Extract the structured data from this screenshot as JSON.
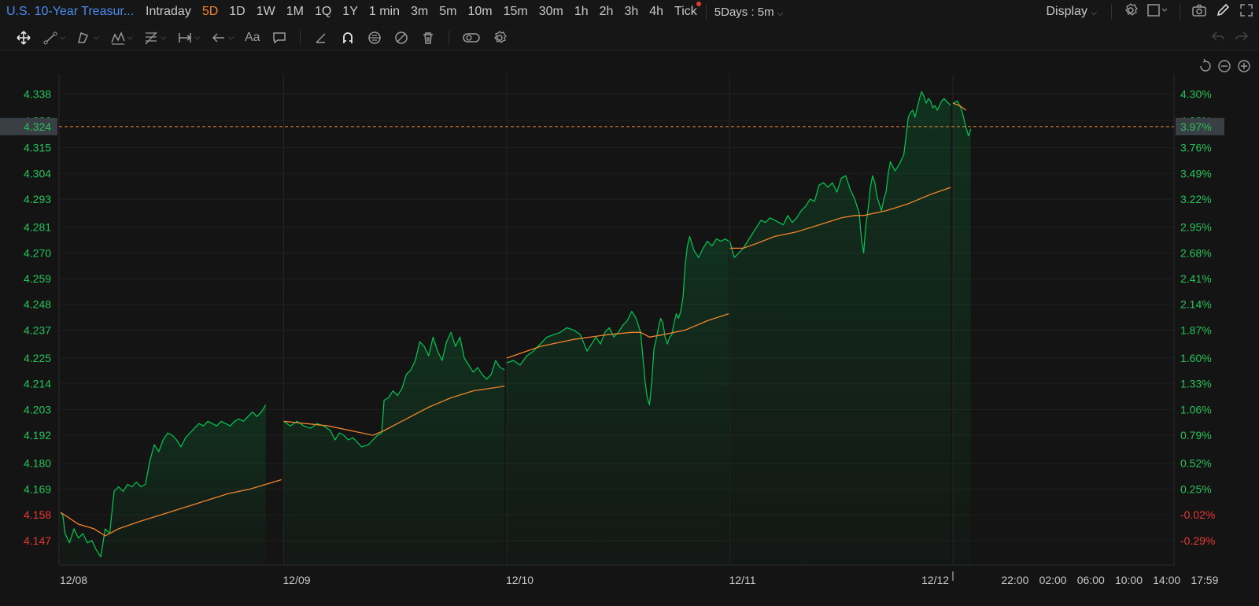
{
  "app": {
    "symbol_title": "U.S. 10-Year Treasur...",
    "timeframes": [
      "Intraday",
      "5D",
      "1D",
      "1W",
      "1M",
      "1Q",
      "1Y",
      "1 min",
      "3m",
      "5m",
      "10m",
      "15m",
      "30m",
      "1h",
      "2h",
      "3h",
      "4h",
      "Tick"
    ],
    "active_timeframe": "5D",
    "period_select": "5Days : 5m",
    "display_label": "Display"
  },
  "toolbar": {
    "text_tool_label": "Aa",
    "icons": [
      "move-icon",
      "trendline-icon",
      "pattern-icon",
      "wave-icon",
      "fib-icon",
      "measure-icon",
      "arrow-icon",
      "text-icon",
      "comment-icon",
      "ruler-icon",
      "magnet-icon",
      "lock-icon",
      "hide-icon",
      "trash-icon",
      "compare-icon",
      "settings-icon",
      "undo-icon",
      "redo-icon"
    ]
  },
  "colors": {
    "price_line": "#00c853",
    "avg_line": "#f0842c",
    "up_text": "#26c35a",
    "down_text": "#e53935",
    "ref_line": "#f0842c",
    "active_tf": "#f0842c",
    "title": "#4a8cf0"
  },
  "chart_data": {
    "type": "area",
    "prev_close": 4.159,
    "current_price": "4.324",
    "current_pct": "3.97%",
    "ylim": [
      4.1365,
      4.3465
    ],
    "left_ticks": [
      "4.338",
      "4.326",
      "4.315",
      "4.304",
      "4.293",
      "4.281",
      "4.270",
      "4.259",
      "4.248",
      "4.237",
      "4.225",
      "4.214",
      "4.203",
      "4.192",
      "4.180",
      "4.169",
      "4.158",
      "4.147"
    ],
    "left_tick_values": [
      4.338,
      4.3265,
      4.315,
      4.304,
      4.293,
      4.281,
      4.27,
      4.259,
      4.248,
      4.237,
      4.225,
      4.214,
      4.203,
      4.192,
      4.18,
      4.169,
      4.158,
      4.147
    ],
    "right_ticks": [
      "4.30%",
      "4.03%",
      "3.76%",
      "3.49%",
      "3.22%",
      "2.95%",
      "2.68%",
      "2.41%",
      "2.14%",
      "1.87%",
      "1.60%",
      "1.33%",
      "1.06%",
      "0.79%",
      "0.52%",
      "0.25%",
      "-0.02%",
      "-0.29%"
    ],
    "x_labels": [
      "12/08",
      "12/09",
      "12/10",
      "12/11",
      "12/12",
      "22:00",
      "02:00",
      "06:00",
      "10:00",
      "14:00",
      "17:59"
    ],
    "x_label_pos": [
      0,
      1,
      2,
      3,
      4,
      4.22,
      4.39,
      4.56,
      4.73,
      4.9,
      5.07
    ],
    "session_breaks": [
      1,
      2,
      3,
      4
    ],
    "days": [
      {
        "name": "12/08",
        "price": [
          [
            0.0,
            4.159
          ],
          [
            0.01,
            4.158
          ],
          [
            0.02,
            4.15
          ],
          [
            0.04,
            4.146
          ],
          [
            0.06,
            4.152
          ],
          [
            0.08,
            4.148
          ],
          [
            0.1,
            4.15
          ],
          [
            0.12,
            4.146
          ],
          [
            0.14,
            4.147
          ],
          [
            0.16,
            4.143
          ],
          [
            0.18,
            4.14
          ],
          [
            0.2,
            4.152
          ],
          [
            0.22,
            4.15
          ],
          [
            0.24,
            4.168
          ],
          [
            0.26,
            4.17
          ],
          [
            0.28,
            4.168
          ],
          [
            0.3,
            4.171
          ],
          [
            0.32,
            4.17
          ],
          [
            0.34,
            4.172
          ],
          [
            0.36,
            4.17
          ],
          [
            0.38,
            4.171
          ],
          [
            0.4,
            4.181
          ],
          [
            0.42,
            4.188
          ],
          [
            0.44,
            4.185
          ],
          [
            0.46,
            4.19
          ],
          [
            0.48,
            4.193
          ],
          [
            0.5,
            4.192
          ],
          [
            0.52,
            4.19
          ],
          [
            0.54,
            4.187
          ],
          [
            0.56,
            4.191
          ],
          [
            0.58,
            4.193
          ],
          [
            0.6,
            4.195
          ],
          [
            0.62,
            4.197
          ],
          [
            0.64,
            4.196
          ],
          [
            0.66,
            4.198
          ],
          [
            0.68,
            4.197
          ],
          [
            0.7,
            4.196
          ],
          [
            0.72,
            4.198
          ],
          [
            0.74,
            4.197
          ],
          [
            0.76,
            4.196
          ],
          [
            0.78,
            4.198
          ],
          [
            0.8,
            4.199
          ],
          [
            0.82,
            4.198
          ],
          [
            0.84,
            4.2
          ],
          [
            0.86,
            4.202
          ],
          [
            0.88,
            4.2
          ],
          [
            0.9,
            4.202
          ],
          [
            0.92,
            4.205
          ]
        ],
        "avg": [
          [
            0.0,
            4.159
          ],
          [
            0.08,
            4.154
          ],
          [
            0.15,
            4.152
          ],
          [
            0.2,
            4.149
          ],
          [
            0.26,
            4.152
          ],
          [
            0.35,
            4.155
          ],
          [
            0.45,
            4.158
          ],
          [
            0.55,
            4.161
          ],
          [
            0.65,
            4.164
          ],
          [
            0.75,
            4.167
          ],
          [
            0.85,
            4.169
          ],
          [
            0.99,
            4.173
          ]
        ]
      },
      {
        "name": "12/09",
        "price": [
          [
            0.0,
            4.198
          ],
          [
            0.03,
            4.196
          ],
          [
            0.06,
            4.198
          ],
          [
            0.09,
            4.196
          ],
          [
            0.12,
            4.195
          ],
          [
            0.15,
            4.197
          ],
          [
            0.18,
            4.196
          ],
          [
            0.21,
            4.194
          ],
          [
            0.23,
            4.19
          ],
          [
            0.25,
            4.193
          ],
          [
            0.27,
            4.192
          ],
          [
            0.29,
            4.19
          ],
          [
            0.31,
            4.191
          ],
          [
            0.33,
            4.189
          ],
          [
            0.35,
            4.187
          ],
          [
            0.38,
            4.188
          ],
          [
            0.4,
            4.19
          ],
          [
            0.42,
            4.192
          ],
          [
            0.44,
            4.193
          ],
          [
            0.45,
            4.207
          ],
          [
            0.47,
            4.208
          ],
          [
            0.49,
            4.211
          ],
          [
            0.51,
            4.209
          ],
          [
            0.53,
            4.212
          ],
          [
            0.55,
            4.218
          ],
          [
            0.57,
            4.22
          ],
          [
            0.59,
            4.224
          ],
          [
            0.61,
            4.232
          ],
          [
            0.63,
            4.23
          ],
          [
            0.65,
            4.226
          ],
          [
            0.67,
            4.234
          ],
          [
            0.69,
            4.228
          ],
          [
            0.71,
            4.224
          ],
          [
            0.73,
            4.232
          ],
          [
            0.75,
            4.236
          ],
          [
            0.77,
            4.23
          ],
          [
            0.79,
            4.234
          ],
          [
            0.81,
            4.225
          ],
          [
            0.83,
            4.222
          ],
          [
            0.85,
            4.219
          ],
          [
            0.87,
            4.221
          ],
          [
            0.89,
            4.218
          ],
          [
            0.91,
            4.216
          ],
          [
            0.93,
            4.218
          ],
          [
            0.95,
            4.224
          ],
          [
            0.97,
            4.221
          ],
          [
            0.99,
            4.22
          ]
        ],
        "avg": [
          [
            0.0,
            4.198
          ],
          [
            0.1,
            4.197
          ],
          [
            0.2,
            4.196
          ],
          [
            0.3,
            4.194
          ],
          [
            0.4,
            4.192
          ],
          [
            0.45,
            4.194
          ],
          [
            0.55,
            4.199
          ],
          [
            0.65,
            4.204
          ],
          [
            0.75,
            4.208
          ],
          [
            0.85,
            4.211
          ],
          [
            0.99,
            4.213
          ]
        ]
      },
      {
        "name": "12/10",
        "price": [
          [
            0.0,
            4.223
          ],
          [
            0.03,
            4.224
          ],
          [
            0.06,
            4.222
          ],
          [
            0.09,
            4.226
          ],
          [
            0.12,
            4.228
          ],
          [
            0.15,
            4.231
          ],
          [
            0.18,
            4.234
          ],
          [
            0.21,
            4.235
          ],
          [
            0.24,
            4.236
          ],
          [
            0.27,
            4.238
          ],
          [
            0.3,
            4.237
          ],
          [
            0.33,
            4.235
          ],
          [
            0.36,
            4.228
          ],
          [
            0.38,
            4.231
          ],
          [
            0.4,
            4.234
          ],
          [
            0.42,
            4.231
          ],
          [
            0.44,
            4.236
          ],
          [
            0.46,
            4.238
          ],
          [
            0.48,
            4.234
          ],
          [
            0.5,
            4.236
          ],
          [
            0.52,
            4.239
          ],
          [
            0.54,
            4.241
          ],
          [
            0.56,
            4.245
          ],
          [
            0.58,
            4.242
          ],
          [
            0.6,
            4.236
          ],
          [
            0.61,
            4.226
          ],
          [
            0.62,
            4.215
          ],
          [
            0.63,
            4.208
          ],
          [
            0.64,
            4.205
          ],
          [
            0.65,
            4.215
          ],
          [
            0.66,
            4.229
          ],
          [
            0.67,
            4.233
          ],
          [
            0.68,
            4.238
          ],
          [
            0.69,
            4.242
          ],
          [
            0.7,
            4.24
          ],
          [
            0.71,
            4.234
          ],
          [
            0.72,
            4.231
          ],
          [
            0.73,
            4.234
          ],
          [
            0.74,
            4.235
          ],
          [
            0.75,
            4.24
          ],
          [
            0.76,
            4.244
          ],
          [
            0.77,
            4.242
          ],
          [
            0.78,
            4.245
          ],
          [
            0.79,
            4.251
          ],
          [
            0.8,
            4.265
          ],
          [
            0.81,
            4.273
          ],
          [
            0.82,
            4.277
          ],
          [
            0.84,
            4.271
          ],
          [
            0.86,
            4.268
          ],
          [
            0.88,
            4.272
          ],
          [
            0.9,
            4.275
          ],
          [
            0.92,
            4.273
          ],
          [
            0.94,
            4.276
          ],
          [
            0.96,
            4.275
          ],
          [
            0.98,
            4.276
          ],
          [
            0.995,
            4.275
          ]
        ],
        "avg": [
          [
            0.0,
            4.225
          ],
          [
            0.15,
            4.23
          ],
          [
            0.3,
            4.233
          ],
          [
            0.45,
            4.235
          ],
          [
            0.56,
            4.236
          ],
          [
            0.6,
            4.236
          ],
          [
            0.64,
            4.234
          ],
          [
            0.7,
            4.235
          ],
          [
            0.8,
            4.237
          ],
          [
            0.9,
            4.241
          ],
          [
            0.995,
            4.244
          ]
        ]
      },
      {
        "name": "12/11",
        "price": [
          [
            0.0,
            4.275
          ],
          [
            0.02,
            4.268
          ],
          [
            0.04,
            4.27
          ],
          [
            0.06,
            4.272
          ],
          [
            0.08,
            4.275
          ],
          [
            0.1,
            4.278
          ],
          [
            0.12,
            4.281
          ],
          [
            0.14,
            4.284
          ],
          [
            0.16,
            4.283
          ],
          [
            0.18,
            4.285
          ],
          [
            0.2,
            4.284
          ],
          [
            0.22,
            4.283
          ],
          [
            0.24,
            4.282
          ],
          [
            0.26,
            4.286
          ],
          [
            0.28,
            4.283
          ],
          [
            0.3,
            4.285
          ],
          [
            0.32,
            4.288
          ],
          [
            0.34,
            4.29
          ],
          [
            0.36,
            4.293
          ],
          [
            0.38,
            4.292
          ],
          [
            0.4,
            4.299
          ],
          [
            0.42,
            4.3
          ],
          [
            0.44,
            4.298
          ],
          [
            0.46,
            4.3
          ],
          [
            0.48,
            4.296
          ],
          [
            0.5,
            4.302
          ],
          [
            0.52,
            4.303
          ],
          [
            0.54,
            4.297
          ],
          [
            0.56,
            4.293
          ],
          [
            0.58,
            4.287
          ],
          [
            0.59,
            4.276
          ],
          [
            0.6,
            4.27
          ],
          [
            0.61,
            4.282
          ],
          [
            0.62,
            4.289
          ],
          [
            0.63,
            4.298
          ],
          [
            0.64,
            4.303
          ],
          [
            0.65,
            4.3
          ],
          [
            0.66,
            4.294
          ],
          [
            0.67,
            4.291
          ],
          [
            0.68,
            4.288
          ],
          [
            0.69,
            4.293
          ],
          [
            0.7,
            4.296
          ],
          [
            0.71,
            4.304
          ],
          [
            0.72,
            4.309
          ],
          [
            0.74,
            4.305
          ],
          [
            0.76,
            4.308
          ],
          [
            0.78,
            4.312
          ],
          [
            0.79,
            4.32
          ],
          [
            0.8,
            4.328
          ],
          [
            0.81,
            4.33
          ],
          [
            0.82,
            4.331
          ],
          [
            0.83,
            4.328
          ],
          [
            0.84,
            4.332
          ],
          [
            0.85,
            4.336
          ],
          [
            0.86,
            4.339
          ],
          [
            0.87,
            4.337
          ],
          [
            0.88,
            4.334
          ],
          [
            0.89,
            4.336
          ],
          [
            0.9,
            4.335
          ],
          [
            0.91,
            4.332
          ],
          [
            0.92,
            4.333
          ],
          [
            0.93,
            4.331
          ],
          [
            0.94,
            4.333
          ],
          [
            0.95,
            4.335
          ],
          [
            0.96,
            4.336
          ],
          [
            0.97,
            4.335
          ],
          [
            0.98,
            4.334
          ],
          [
            0.99,
            4.333
          ]
        ],
        "avg": [
          [
            0.0,
            4.272
          ],
          [
            0.06,
            4.272
          ],
          [
            0.12,
            4.274
          ],
          [
            0.2,
            4.277
          ],
          [
            0.3,
            4.279
          ],
          [
            0.4,
            4.282
          ],
          [
            0.5,
            4.285
          ],
          [
            0.56,
            4.286
          ],
          [
            0.6,
            4.286
          ],
          [
            0.7,
            4.288
          ],
          [
            0.8,
            4.291
          ],
          [
            0.9,
            4.295
          ],
          [
            0.99,
            4.298
          ]
        ]
      },
      {
        "name": "12/12",
        "price": [
          [
            0.0,
            4.334
          ],
          [
            0.02,
            4.335
          ],
          [
            0.04,
            4.331
          ],
          [
            0.055,
            4.325
          ],
          [
            0.07,
            4.32
          ],
          [
            0.08,
            4.323
          ]
        ],
        "avg": [
          [
            0.0,
            4.334
          ],
          [
            0.03,
            4.333
          ],
          [
            0.06,
            4.331
          ]
        ]
      }
    ]
  }
}
